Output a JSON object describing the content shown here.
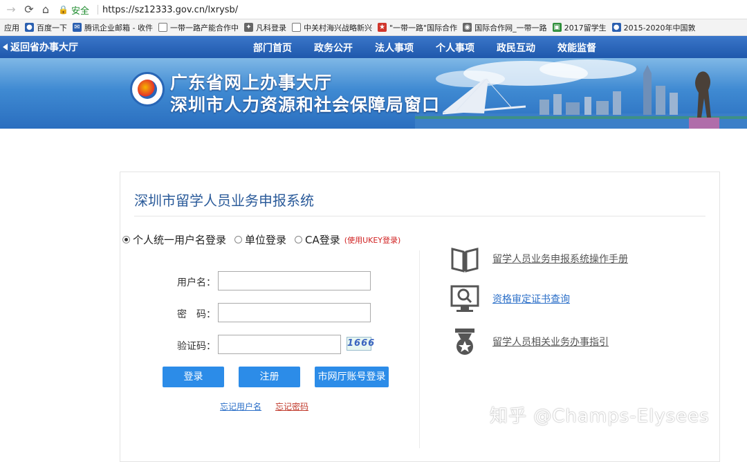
{
  "browser": {
    "secure_label": "安全",
    "url": "https://sz12333.gov.cn/lxrysb/",
    "bookmarks": [
      {
        "label": "应用",
        "icon": "apps-icon"
      },
      {
        "label": "百度一下",
        "icon": "baidu-icon"
      },
      {
        "label": "腾讯企业邮箱 - 收件",
        "icon": "mail-icon"
      },
      {
        "label": "一带一路产能合作中",
        "icon": "doc-icon"
      },
      {
        "label": "凡科登录",
        "icon": "fanke-icon"
      },
      {
        "label": "中关村海兴战略新兴",
        "icon": "doc-icon"
      },
      {
        "label": "\"一带一路\"国际合作",
        "icon": "emblem-icon"
      },
      {
        "label": "国际合作网_一带一路",
        "icon": "globe-icon"
      },
      {
        "label": "2017留学生",
        "icon": "green-box-icon"
      },
      {
        "label": "2015-2020年中国敦",
        "icon": "baidu-icon"
      }
    ]
  },
  "site_nav": {
    "back_label": "返回省办事大厅",
    "menu": [
      "部门首页",
      "政务公开",
      "法人事项",
      "个人事项",
      "政民互动",
      "效能监督"
    ]
  },
  "banner": {
    "title_line1": "广东省网上办事大厅",
    "title_line2": "深圳市人力资源和社会保障局窗口"
  },
  "main": {
    "system_title": "深圳市留学人员业务申报系统",
    "login_modes": [
      {
        "label": "个人统一用户名登录",
        "selected": true
      },
      {
        "label": "单位登录",
        "selected": false
      },
      {
        "label": "CA登录",
        "selected": false
      }
    ],
    "ukey_note": "(使用UKEY登录)",
    "form": {
      "username_label": "用户名：",
      "password_label": "密　码：",
      "captcha_label": "验证码：",
      "captcha_text": "1666"
    },
    "buttons": {
      "login": "登录",
      "register": "注册",
      "city_account_login": "市网厅账号登录"
    },
    "links": {
      "forgot_username": "忘记用户名",
      "forgot_password": "忘记密码"
    },
    "side_links": [
      {
        "label": "留学人员业务申报系统操作手册",
        "icon": "book-icon"
      },
      {
        "label": "资格审定证书查询",
        "icon": "monitor-search-icon"
      },
      {
        "label": "留学人员相关业务办事指引",
        "icon": "badge-star-icon"
      }
    ]
  },
  "watermark": "知乎 @Champs-Elysees",
  "colors": {
    "nav_bar": "#2a64b8",
    "button_blue": "#2c8ce8",
    "title_blue": "#2b5b9a",
    "link_red": "#c0392b",
    "link_blue": "#2b6fc8",
    "ukey_red": "#d02020"
  }
}
